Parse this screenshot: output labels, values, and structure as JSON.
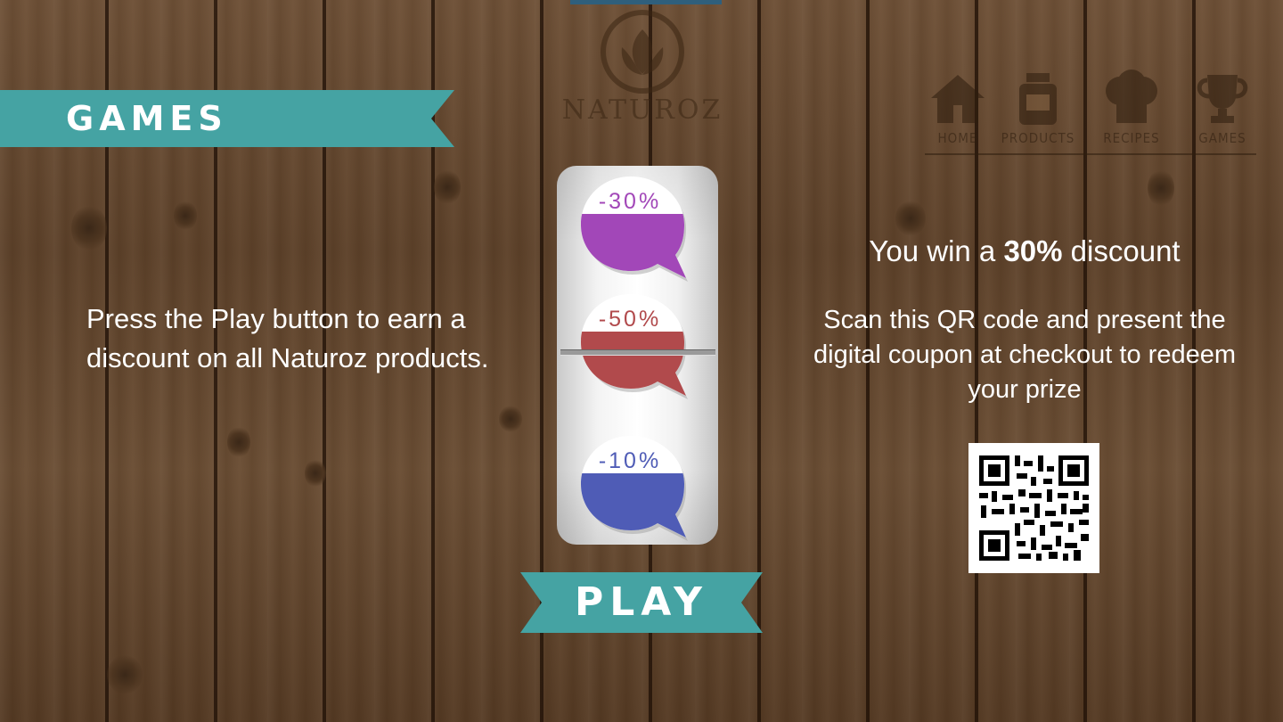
{
  "app": {
    "brand": "NATUROZ"
  },
  "nav": {
    "items": [
      {
        "label": "HOME",
        "icon": "house-icon"
      },
      {
        "label": "PRODUCTS",
        "icon": "jar-icon"
      },
      {
        "label": "RECIPES",
        "icon": "chef-hat-icon"
      },
      {
        "label": "GAMES",
        "icon": "trophy-icon"
      }
    ]
  },
  "page": {
    "title": "GAMES"
  },
  "instructions": "Press the Play button to earn a discount on all Naturoz products.",
  "slot": {
    "reels": [
      {
        "label": "-30%",
        "color": "#a247b8"
      },
      {
        "label": "-50%",
        "color": "#b14a4c"
      },
      {
        "label": "-10%",
        "color": "#4f5cb6"
      }
    ]
  },
  "play_button": {
    "label": "PLAY"
  },
  "result": {
    "win_prefix": "You win a ",
    "win_amount": "30%",
    "win_suffix": " discount",
    "instructions": "Scan this QR code and present the digital coupon at checkout to redeem your prize"
  },
  "colors": {
    "accent": "#45a3a3",
    "wood": "#5d4129"
  }
}
